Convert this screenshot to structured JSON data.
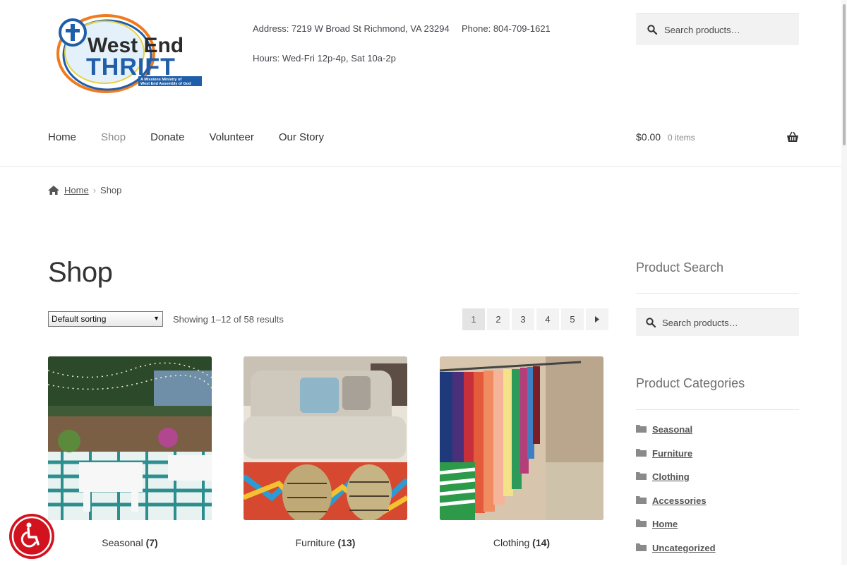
{
  "header": {
    "logo": {
      "line1": "West End",
      "line2": "THRIFT",
      "tagline1": "A Missions Ministry of",
      "tagline2": "West End Assembly of God"
    },
    "address": "Address: 7219 W Broad St Richmond, VA 23294",
    "phone": "Phone: 804-709-1621",
    "hours": "Hours: Wed-Fri 12p-4p, Sat 10a-2p",
    "search_placeholder": "Search products…"
  },
  "nav": {
    "items": [
      {
        "label": "Home"
      },
      {
        "label": "Shop"
      },
      {
        "label": "Donate"
      },
      {
        "label": "Volunteer"
      },
      {
        "label": "Our Story"
      }
    ]
  },
  "cart": {
    "total": "$0.00",
    "count": "0 items"
  },
  "breadcrumb": {
    "home": "Home",
    "current": "Shop"
  },
  "page": {
    "title": "Shop",
    "sorting": "Default sorting",
    "result_count": "Showing 1–12 of 58 results",
    "pages": [
      "1",
      "2",
      "3",
      "4",
      "5"
    ]
  },
  "products": [
    {
      "name": "Seasonal",
      "count": "(7)"
    },
    {
      "name": "Furniture",
      "count": "(13)"
    },
    {
      "name": "Clothing",
      "count": "(14)"
    }
  ],
  "sidebar": {
    "product_search_title": "Product Search",
    "search_placeholder": "Search products…",
    "categories_title": "Product Categories",
    "categories": [
      "Seasonal",
      "Furniture",
      "Clothing",
      "Accessories",
      "Home",
      "Uncategorized"
    ]
  },
  "colors": {
    "accessibility": "#d2131f",
    "logo_blue": "#1f5ea8",
    "logo_orange": "#f07a1e"
  }
}
